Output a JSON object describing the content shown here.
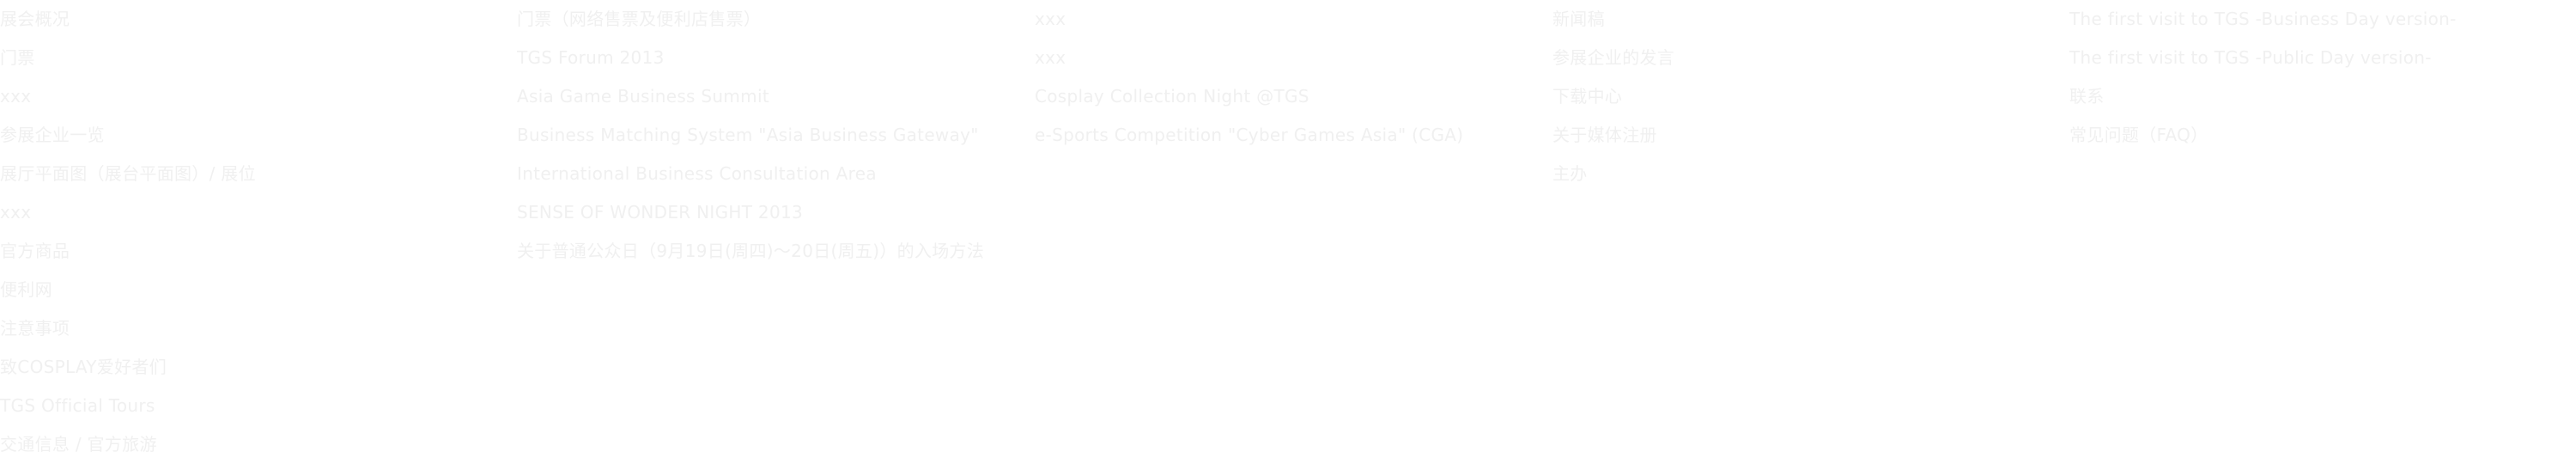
{
  "sitemap": {
    "col1": [
      "展会概况",
      "门票",
      "xxx",
      "参展企业一览",
      "展厅平面图（展台平面图）/ 展位",
      "xxx",
      "官方商品",
      "便利网",
      "注意事项",
      "致COSPLAY爱好者们",
      "TGS Official Tours",
      "交通信息 / 官方旅游"
    ],
    "col2": [
      "门票（网络售票及便利店售票）",
      "TGS Forum 2013",
      "Asia Game Business Summit",
      "Business Matching System \"Asia Business Gateway\"",
      "International Business Consultation Area",
      "SENSE OF WONDER NIGHT 2013",
      "关于普通公众日（9月19日(周四)～20日(周五)）的入场方法"
    ],
    "col3": [
      "xxx",
      "xxx",
      "Cosplay Collection Night @TGS",
      "e-Sports Competition \"Cyber Games Asia\" (CGA)"
    ],
    "col4": [
      "新闻稿",
      "参展企业的发言",
      "下载中心",
      "关于媒体注册",
      "主办"
    ],
    "col5": [
      "The first visit to TGS -Business Day version-",
      "The first visit to TGS -Public Day version-",
      "联系",
      "常见问题（FAQ）"
    ]
  }
}
